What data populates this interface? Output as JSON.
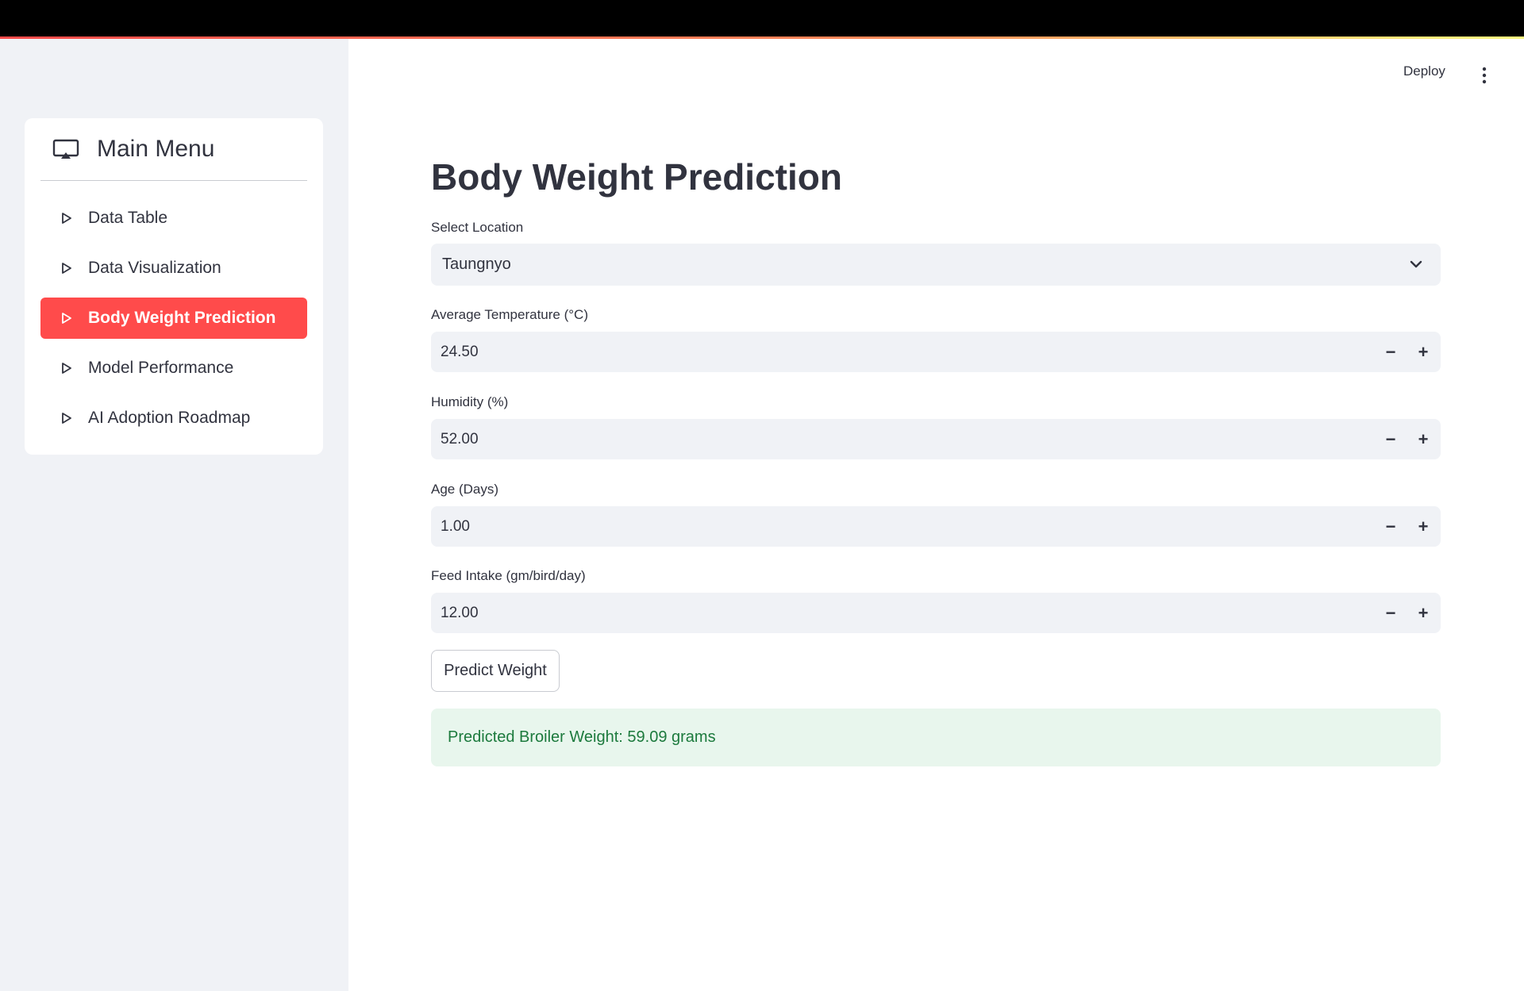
{
  "app": {
    "deploy_label": "Deploy",
    "menu_icon": "kebab-vertical-icon"
  },
  "sidebar": {
    "menu_title": "Main Menu",
    "menu_icon": "airplay-display-icon",
    "items": [
      {
        "label": "Data Table",
        "active": false
      },
      {
        "label": "Data Visualization",
        "active": false
      },
      {
        "label": "Body Weight Prediction",
        "active": true
      },
      {
        "label": "Model Performance",
        "active": false
      },
      {
        "label": "AI Adoption Roadmap",
        "active": false
      }
    ],
    "active_color": "#ff4b4b"
  },
  "main": {
    "title": "Body Weight Prediction",
    "location": {
      "label": "Select Location",
      "value": "Taungnyo"
    },
    "inputs": [
      {
        "label": "Average Temperature (°C)",
        "value": "24.50"
      },
      {
        "label": "Humidity (%)",
        "value": "52.00"
      },
      {
        "label": "Age (Days)",
        "value": "1.00"
      },
      {
        "label": "Feed Intake (gm/bird/day)",
        "value": "12.00"
      }
    ],
    "stepper": {
      "minus": "−",
      "plus": "+"
    },
    "predict_button": "Predict Weight",
    "result_text": "Predicted Broiler Weight: 59.09 grams",
    "result_color": "#1c7a3d"
  }
}
